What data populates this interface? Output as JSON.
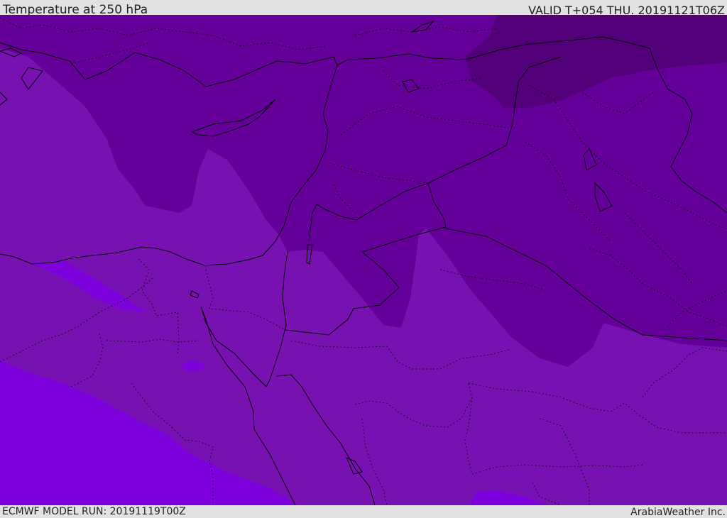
{
  "header": {
    "title": "Temperature at 250 hPa",
    "valid": "VALID T+054 THU. 20191121T06Z"
  },
  "footer": {
    "model_run": "ECMWF MODEL RUN: 20191119T00Z",
    "credit": "ArabiaWeather Inc."
  },
  "map": {
    "colors": {
      "coldest": "#520079",
      "cold": "#640099",
      "cool": "#7811b1",
      "warm": "#7d00dd",
      "border": "#000000"
    }
  }
}
